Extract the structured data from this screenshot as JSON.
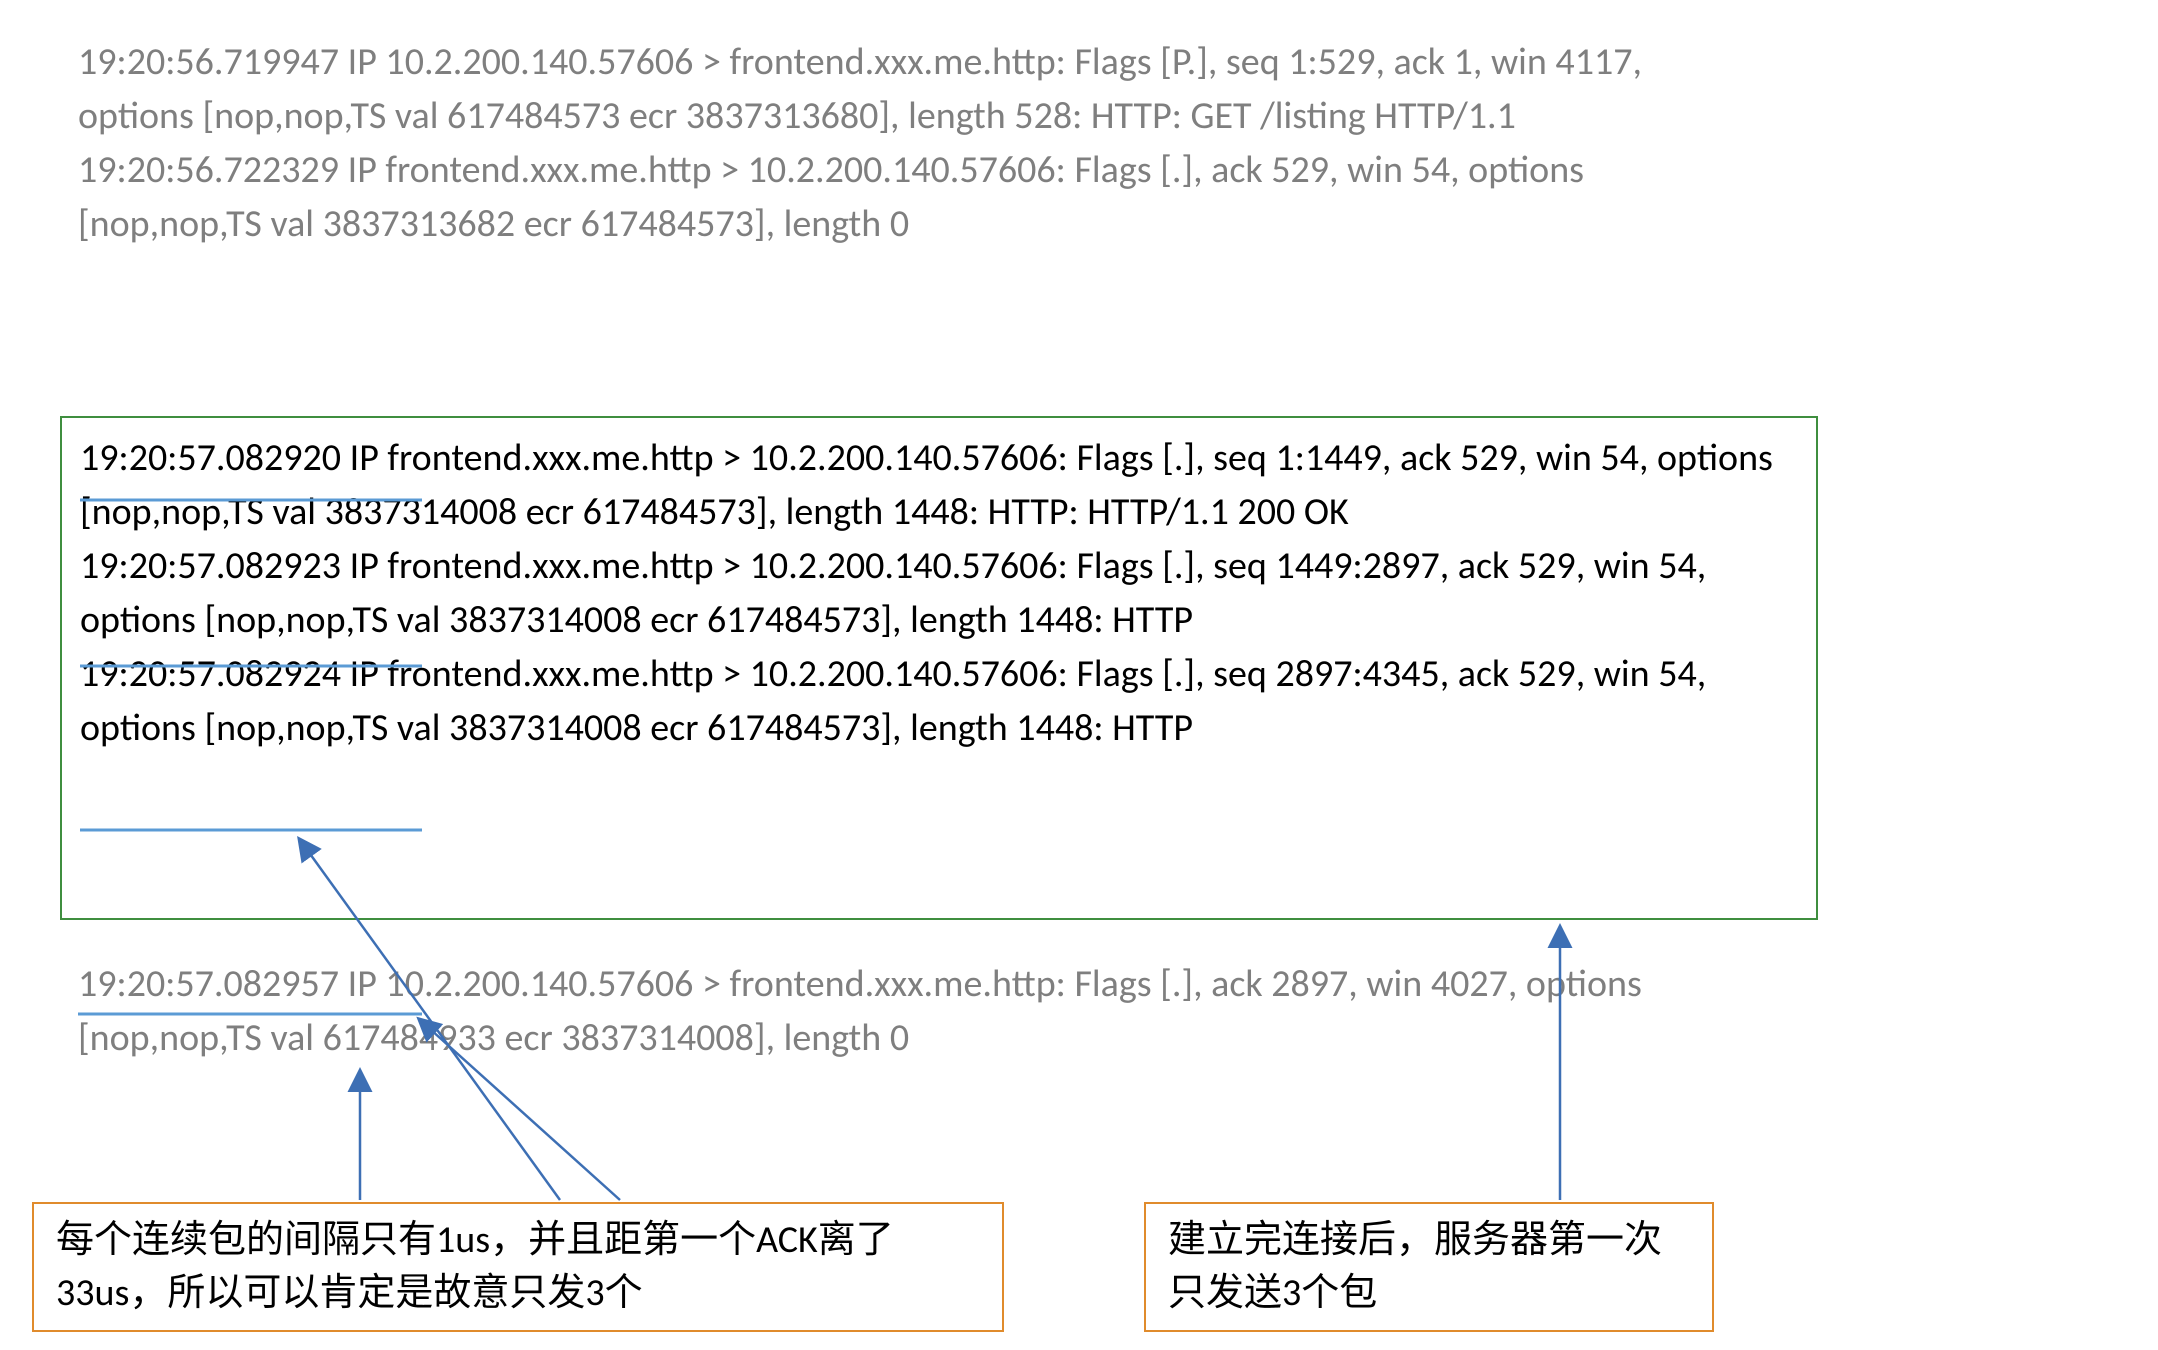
{
  "tcpdump": {
    "top_block": "19:20:56.719947 IP 10.2.200.140.57606 > frontend.xxx.me.http: Flags [P.], seq 1:529, ack 1, win 4117, options [nop,nop,TS val 617484573 ecr 3837313680], length 528: HTTP: GET /listing HTTP/1.1\n19:20:56.722329 IP frontend.xxx.me.http > 10.2.200.140.57606: Flags [.], ack 529, win 54, options [nop,nop,TS val 3837313682 ecr 617484573], length 0",
    "boxed_block": "19:20:57.082920 IP frontend.xxx.me.http > 10.2.200.140.57606: Flags [.], seq 1:1449, ack 529, win 54, options [nop,nop,TS val 3837314008 ecr 617484573], length 1448: HTTP: HTTP/1.1 200 OK\n19:20:57.082923 IP frontend.xxx.me.http > 10.2.200.140.57606: Flags [.], seq 1449:2897, ack 529, win 54, options [nop,nop,TS val 3837314008 ecr 617484573], length 1448: HTTP\n19:20:57.082924 IP frontend.xxx.me.http > 10.2.200.140.57606: Flags [.], seq 2897:4345, ack 529, win 54, options [nop,nop,TS val 3837314008 ecr 617484573], length 1448: HTTP",
    "bottom_block": "19:20:57.082957 IP 10.2.200.140.57606 > frontend.xxx.me.http: Flags [.], ack 2897, win 4027, options [nop,nop,TS val 617484933 ecr 3837314008], length 0"
  },
  "callouts": {
    "left": "每个连续包的间隔只有1us，并且距第一个ACK离了33us，所以可以肯定是故意只发3个",
    "right": "建立完连接后，服务器第一次只发送3个包"
  },
  "colors": {
    "green_border": "#3f8e3f",
    "orange_border": "#e08b2c",
    "blue_arrow": "#3d6fb4",
    "underline": "#5b9bd5",
    "gray_text": "#7f7f7f"
  }
}
